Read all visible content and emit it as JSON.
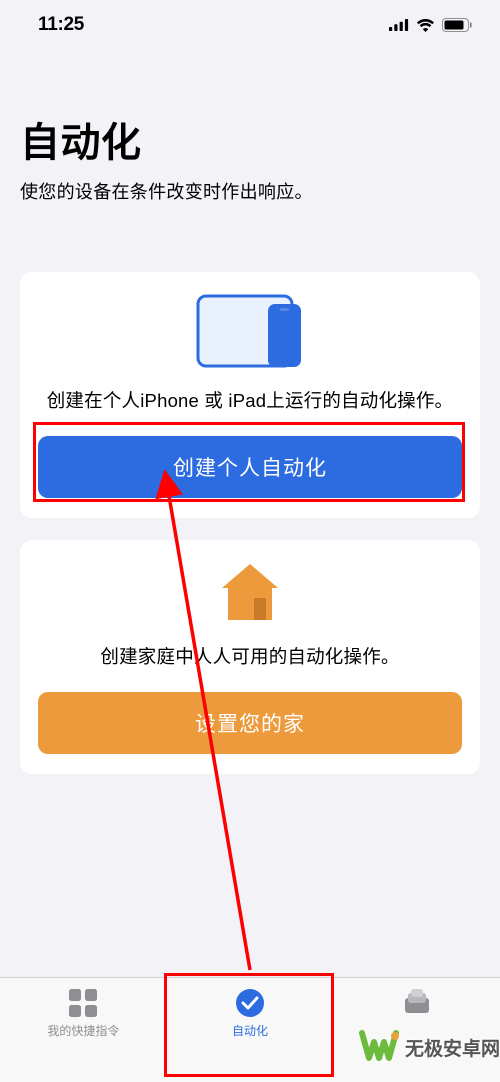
{
  "status": {
    "time": "11:25"
  },
  "header": {
    "title": "自动化",
    "subtitle": "使您的设备在条件改变时作出响应。"
  },
  "personal_card": {
    "description": "创建在个人iPhone 或 iPad上运行的自动化操作。",
    "button_label": "创建个人自动化"
  },
  "home_card": {
    "description": "创建家庭中人人可用的自动化操作。",
    "button_label": "设置您的家"
  },
  "tabs": {
    "shortcuts": "我的快捷指令",
    "automation": "自动化",
    "gallery": ""
  },
  "watermark": {
    "text": "无极安卓网"
  }
}
